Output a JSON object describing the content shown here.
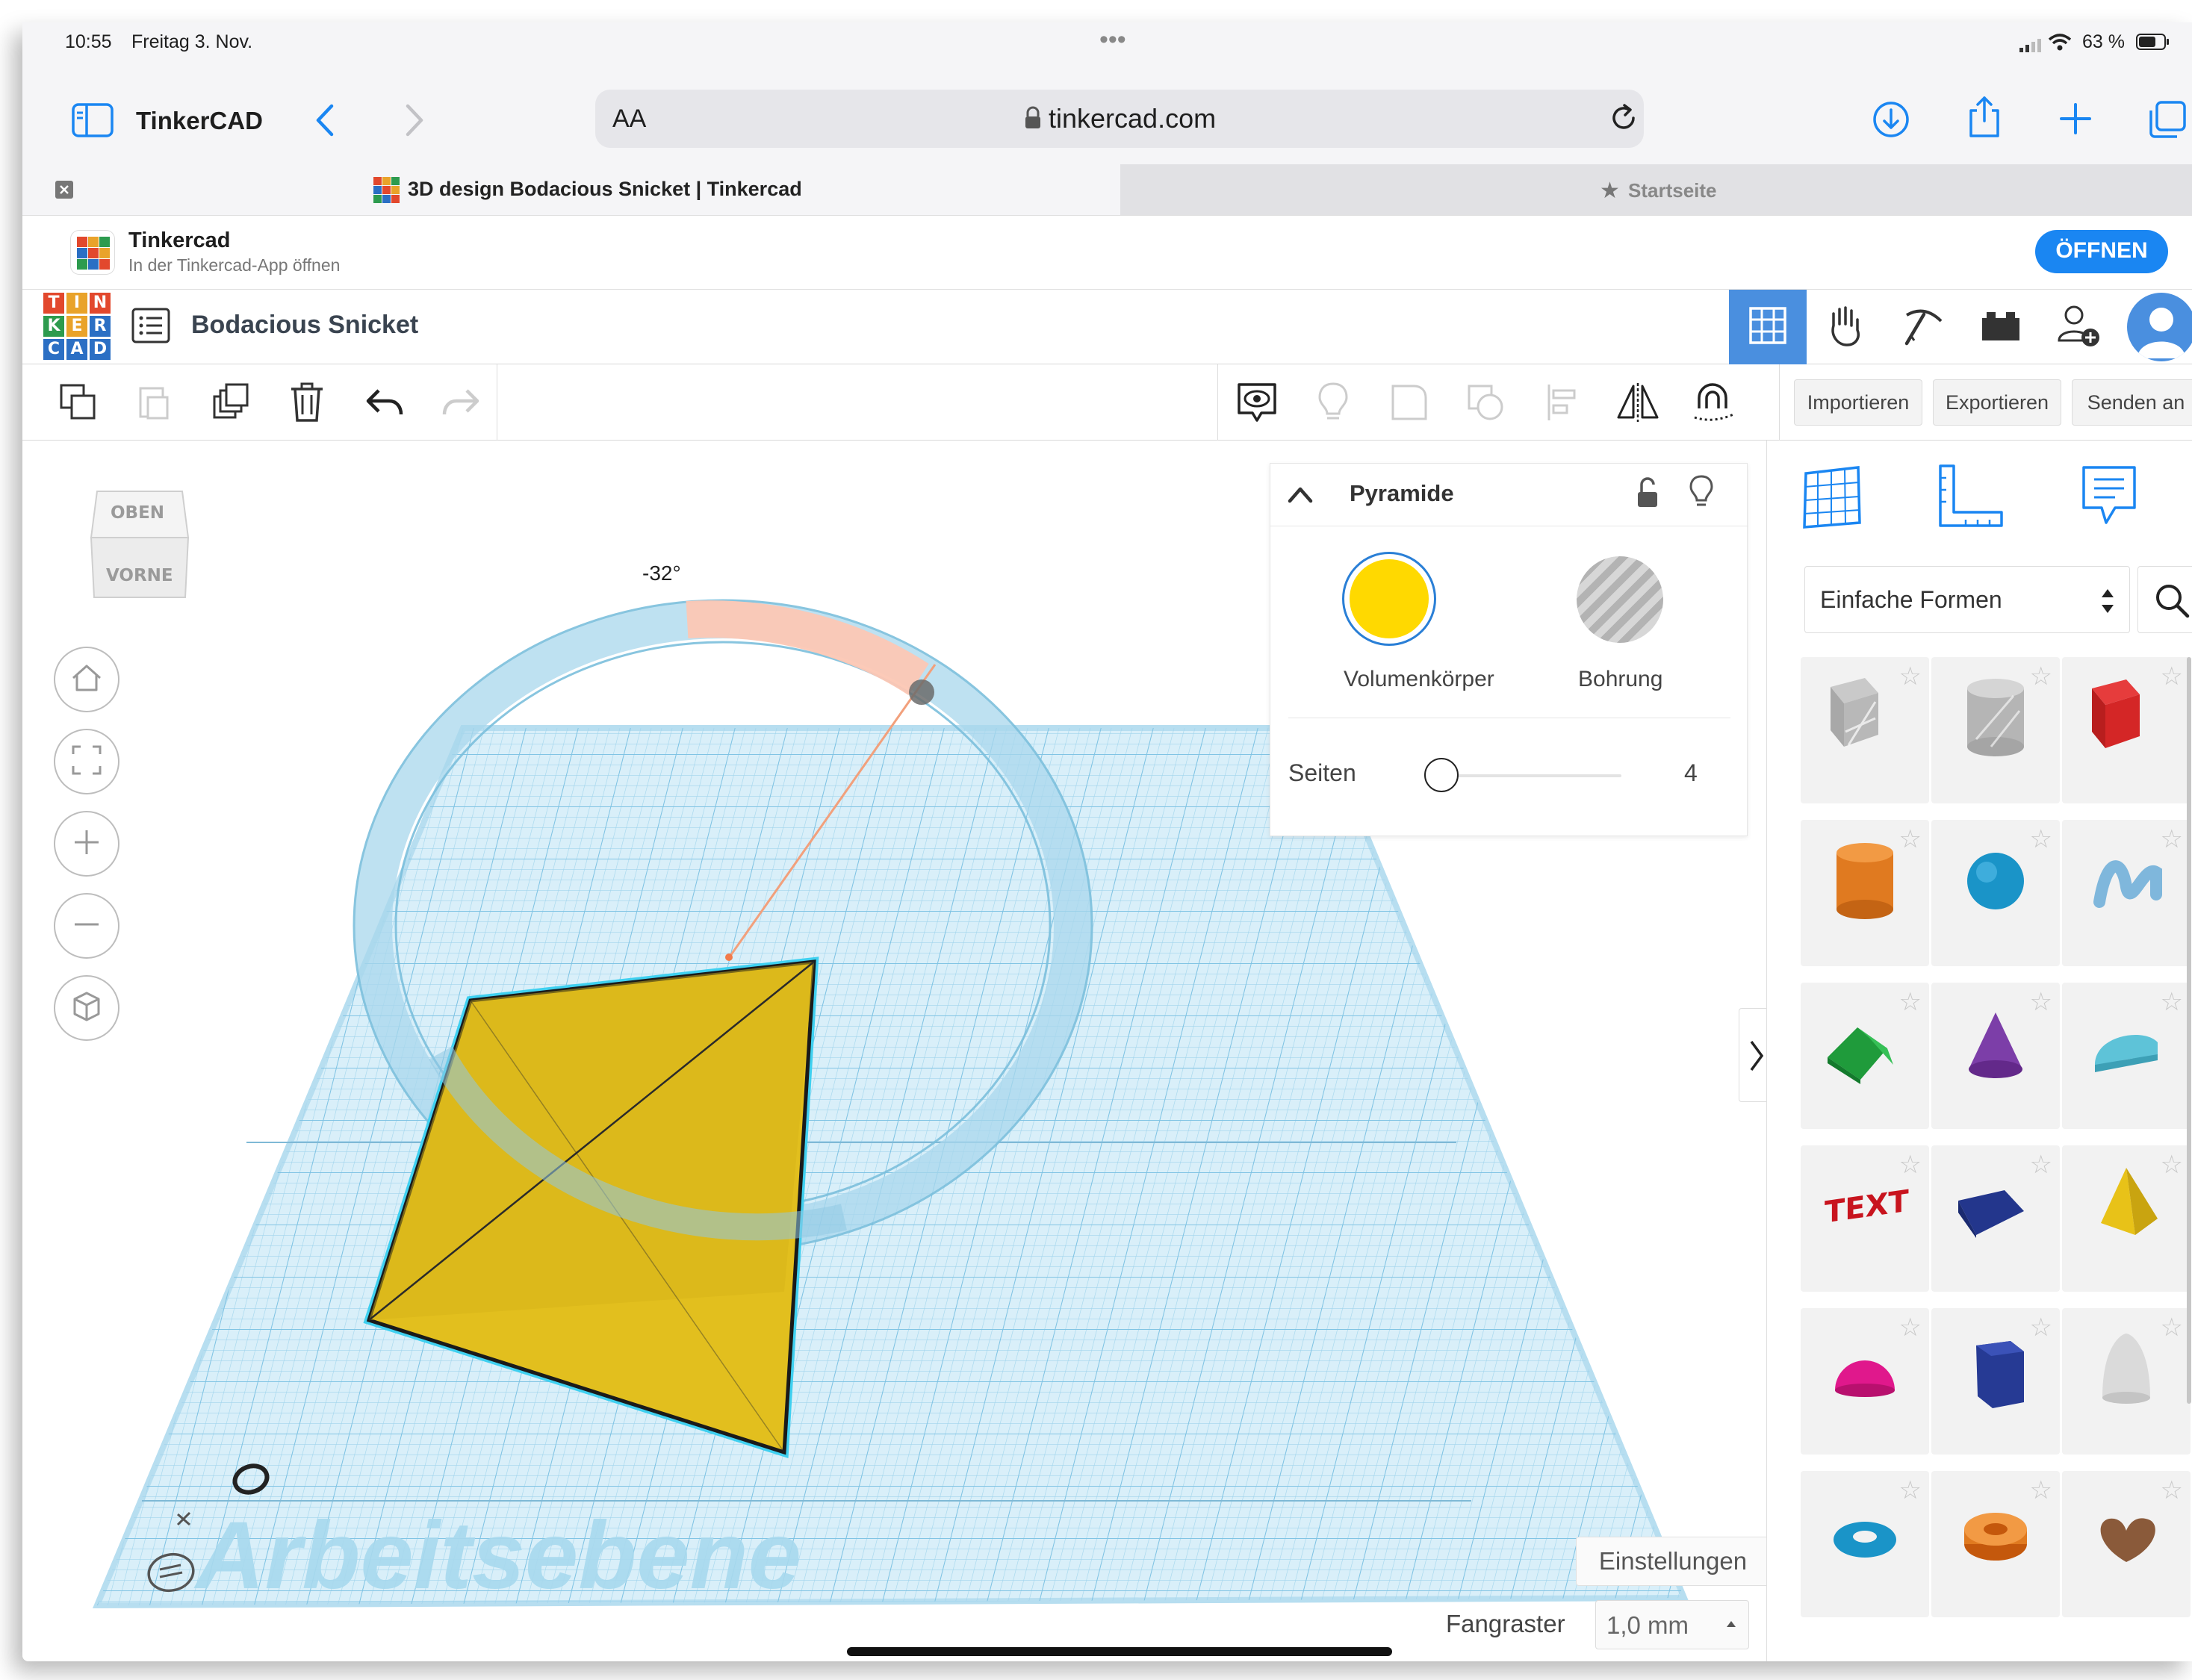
{
  "status_bar": {
    "time": "10:55",
    "date": "Freitag 3. Nov.",
    "dots": "•••",
    "battery": "63 %"
  },
  "browser": {
    "sidebar_label": "TinkerCAD",
    "text_size": "AA",
    "url": "tinkercad.com",
    "tabs": [
      {
        "label": "3D design Bodacious Snicket | Tinkercad",
        "active": true
      },
      {
        "label": "Startseite",
        "active": false
      }
    ]
  },
  "app_banner": {
    "title": "Tinkercad",
    "subtitle": "In der Tinkercad-App öffnen",
    "open_button": "ÖFFNEN"
  },
  "tinkercad": {
    "logo_letters": [
      "T",
      "I",
      "N",
      "K",
      "E",
      "R",
      "C",
      "A",
      "D"
    ],
    "design_title": "Bodacious Snicket",
    "toolbar_buttons": {
      "import": "Importieren",
      "export": "Exportieren",
      "send": "Senden an"
    },
    "view_cube": {
      "top": "OBEN",
      "front": "VORNE"
    },
    "rotation_angle": "-32°",
    "workplane_label": "Arbeitsebene",
    "settings_button": "Einstellungen",
    "snap_grid": {
      "label": "Fangraster",
      "value": "1,0 mm"
    }
  },
  "inspector": {
    "title": "Pyramide",
    "solid_label": "Volumenkörper",
    "hole_label": "Bohrung",
    "solid_color": "#ffd900",
    "sides_label": "Seiten",
    "sides_value": "4"
  },
  "shapes_panel": {
    "category": "Einfache Formen",
    "shapes": [
      "box-hole",
      "cylinder-hole",
      "box",
      "cylinder",
      "sphere",
      "scribble",
      "roof",
      "cone",
      "round-roof",
      "text",
      "wedge",
      "pyramid",
      "half-sphere",
      "polygon",
      "paraboloid",
      "torus",
      "tube",
      "heart"
    ]
  },
  "colors": {
    "accent": "#1a86f2",
    "active_header": "#4a8fdf",
    "grid": "#9fd3ec"
  }
}
